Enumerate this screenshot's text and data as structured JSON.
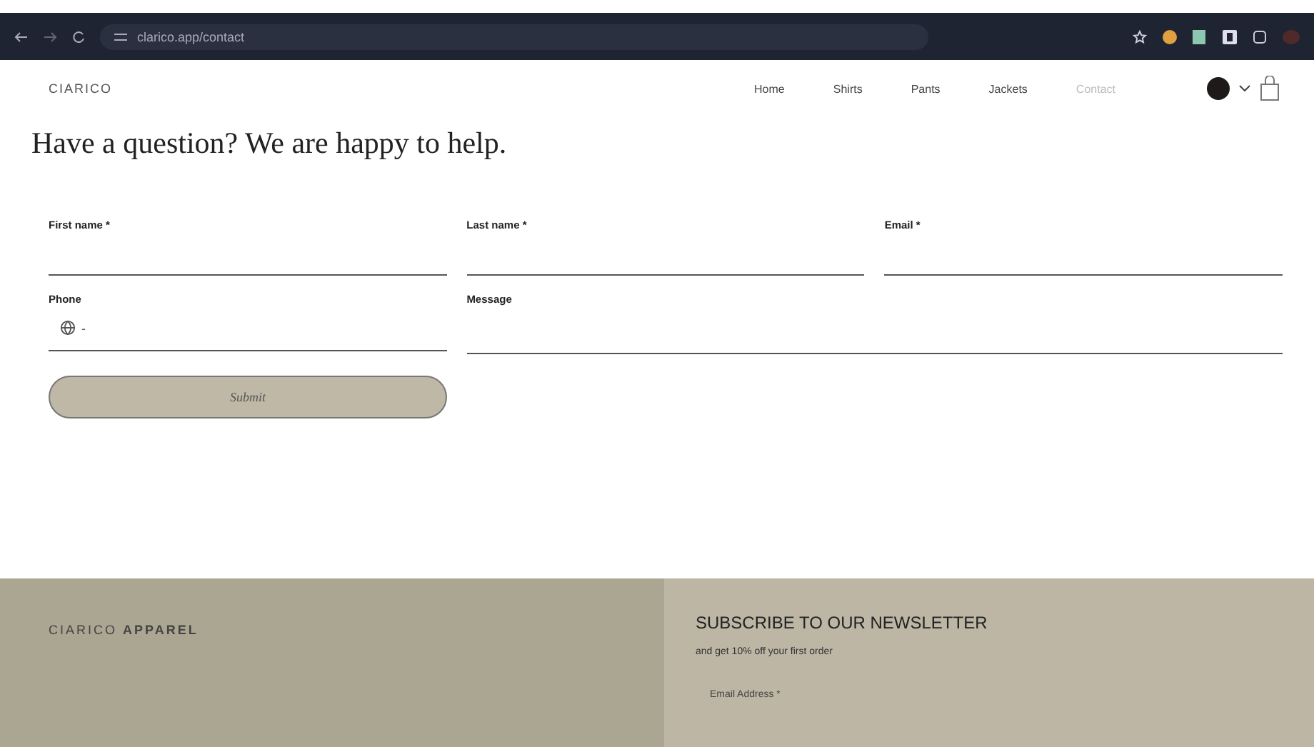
{
  "browser": {
    "url": "clarico.app/contact"
  },
  "header": {
    "logo": "CIARICO",
    "nav": [
      {
        "label": "Home",
        "selected": false
      },
      {
        "label": "Shirts",
        "selected": false
      },
      {
        "label": "Pants",
        "selected": false
      },
      {
        "label": "Jackets",
        "selected": false
      },
      {
        "label": "Contact",
        "selected": true
      }
    ]
  },
  "heading": "Have a question? We are happy to help.",
  "form": {
    "fields": [
      {
        "label": "First name *",
        "kind": "text"
      },
      {
        "label": "Last name *",
        "kind": "text"
      },
      {
        "label": "Email *",
        "kind": "text"
      },
      {
        "label": "Phone",
        "kind": "phone",
        "prefix": "-"
      },
      {
        "label": "Message",
        "kind": "wide"
      }
    ],
    "submit": "Submit"
  },
  "footer": {
    "brand": "CIARICO",
    "brand_bold": "APPAREL",
    "newsletter_title": "SUBSCRIBE TO OUR NEWSLETTER",
    "newsletter_text": "and get 10% off your first order",
    "email_placeholder": "Email Address *"
  }
}
